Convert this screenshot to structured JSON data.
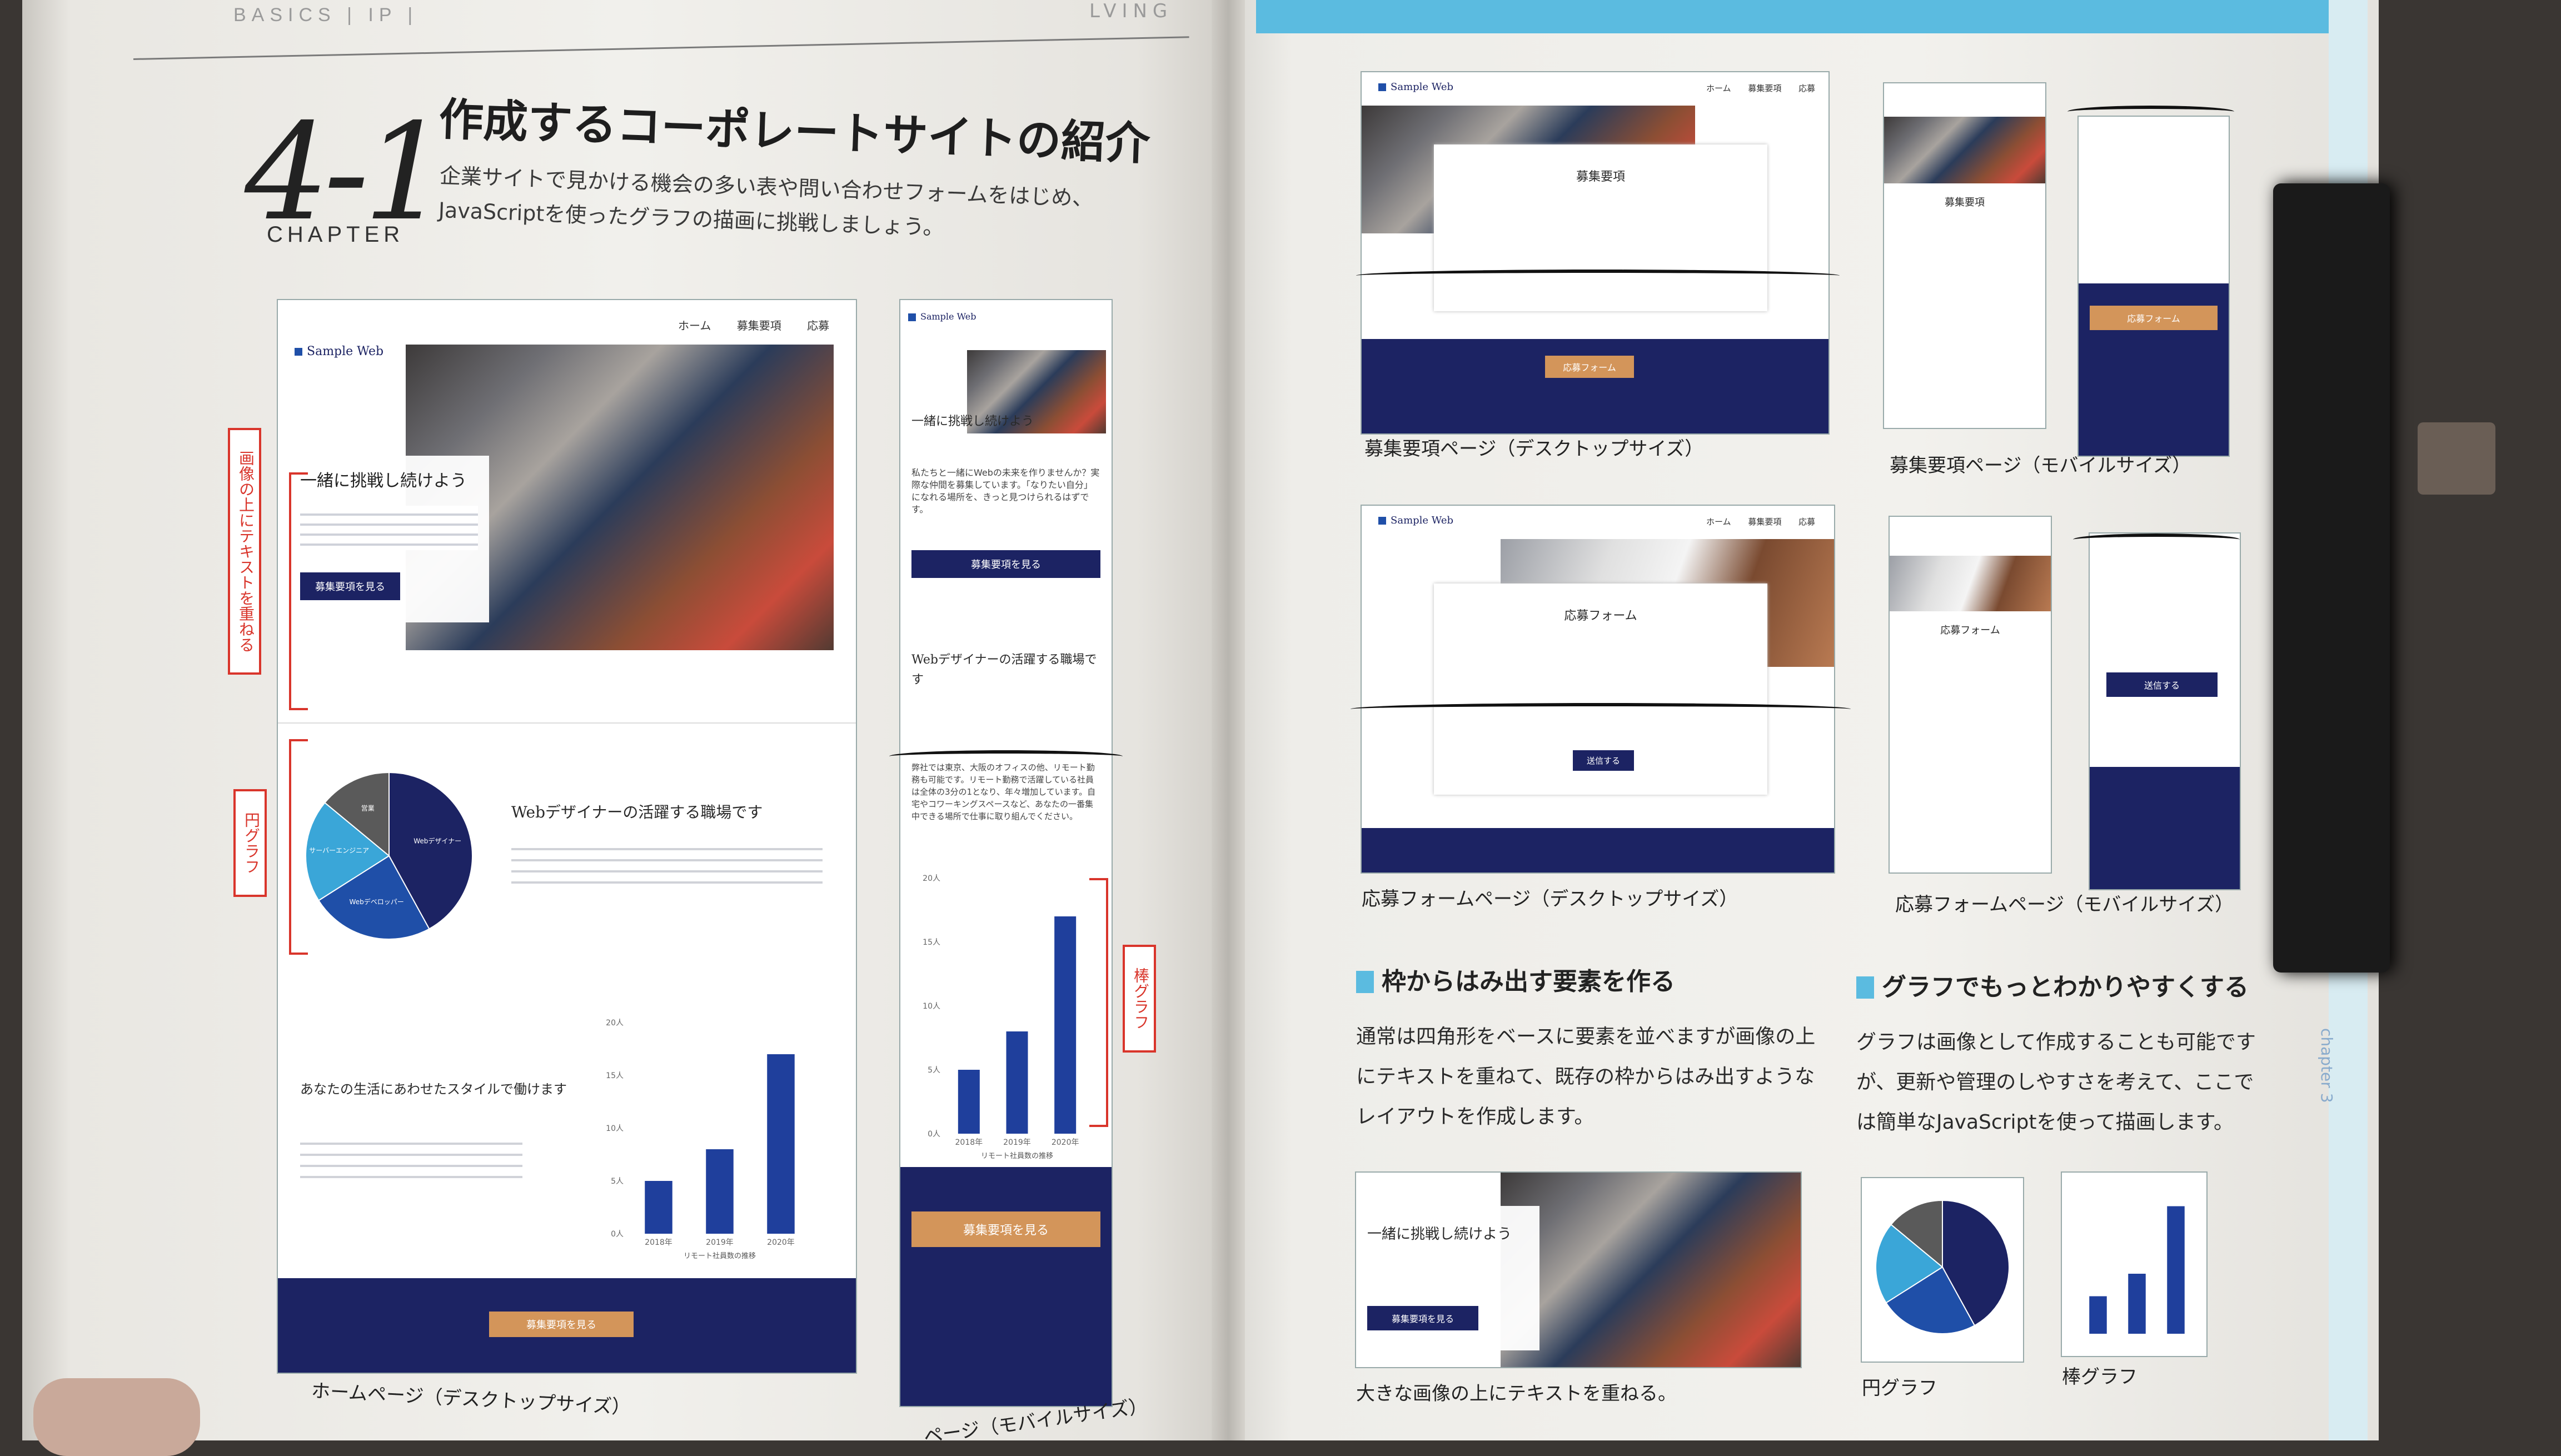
{
  "running_head": {
    "left": "BASICS | IP |",
    "right": "LVING"
  },
  "chapter": {
    "number": "4-1",
    "word": "CHAPTER",
    "title": "作成するコーポレートサイトの紹介",
    "lead": "企業サイトで見かける機会の多い表や問い合わせフォームをはじめ、JavaScriptを使ったグラフの描画に挑戦しましょう。"
  },
  "desktop_home": {
    "logo": "Sample Web",
    "nav": [
      "ホーム",
      "募集要項",
      "応募"
    ],
    "hero_heading": "一緒に挑戦し続けよう",
    "hero_button": "募集要項を見る",
    "section_heading": "Webデザイナーの活躍する職場です",
    "style_heading": "あなたの生活にあわせたスタイルで働けます",
    "footer_button": "募集要項を見る",
    "caption": "ホームページ（デスクトップサイズ）"
  },
  "mobile_home": {
    "logo": "Sample Web",
    "hero_heading": "一緒に挑戦し続けよう",
    "hero_text": "私たちと一緒にWebの未来を作りませんか？実際な仲間を募集しています。「なりたい自分」になれる場所を、きっと見つけられるはずです。",
    "hero_button": "募集要項を見る",
    "section_heading": "Webデザイナーの活躍する職場です",
    "body_text": "弊社では東京、大阪のオフィスの他、リモート勤務も可能です。リモート勤務で活躍している社員は全体の3分の1となり、年々増加しています。自宅やコワーキングスペースなど、あなたの一番集中できる場所で仕事に取り組んでください。",
    "footer_button": "募集要項を見る",
    "caption": "ページ（モバイルサイズ）"
  },
  "annotations": {
    "overlap_text": "画像の上にテキストを重ねる",
    "pie": "円グラフ",
    "bar": "棒グラフ"
  },
  "chart_data": [
    {
      "type": "bar",
      "categories": [
        "2018年",
        "2019年",
        "2020年"
      ],
      "values": [
        5,
        8,
        17
      ],
      "ylim": [
        0,
        20
      ],
      "y_ticks": [
        "0人",
        "5人",
        "10人",
        "15人",
        "20人"
      ],
      "xlabel": "リモート社員数の推移",
      "colors": [
        "#1f3f9c"
      ]
    },
    {
      "type": "pie",
      "labels": [
        "Webデザイナー",
        "Webデベロッパー",
        "サーバーエンジニア",
        "営業"
      ],
      "values": [
        42,
        24,
        20,
        14
      ],
      "colors": [
        "#1c2363",
        "#1f4fa8",
        "#3aa6d8",
        "#5a5a5a"
      ]
    }
  ],
  "right_page": {
    "recruit_desktop": {
      "logo": "Sample Web",
      "nav": [
        "ホーム",
        "募集要項",
        "応募"
      ],
      "heading": "募集要項",
      "button": "応募フォーム",
      "caption": "募集要項ページ（デスクトップサイズ）"
    },
    "recruit_mobile": {
      "heading": "募集要項",
      "button": "応募フォーム",
      "caption": "募集要項ページ（モバイルサイズ）"
    },
    "form_desktop": {
      "logo": "Sample Web",
      "nav": [
        "ホーム",
        "募集要項",
        "応募"
      ],
      "heading": "応募フォーム",
      "button": "送信する",
      "caption": "応募フォームページ（デスクトップサイズ）"
    },
    "form_mobile": {
      "heading": "応募フォーム",
      "button": "送信する",
      "caption": "応募フォームページ（モバイルサイズ）"
    },
    "section1": {
      "heading": "枠からはみ出す要素を作る",
      "body": "通常は四角形をベースに要素を並べますが画像の上にテキストを重ねて、既存の枠からはみ出すようなレイアウトを作成します。"
    },
    "section2": {
      "heading": "グラフでもっとわかりやすくする",
      "body": "グラフは画像として作成することも可能ですが、更新や管理のしやすさを考えて、ここでは簡単なJavaScriptを使って描画します。"
    },
    "example_caption": "大きな画像の上にテキストを重ねる。",
    "example_heading": "一緒に挑戦し続けよう",
    "example_button": "募集要項を見る",
    "pie_caption": "円グラフ",
    "bar_caption": "棒グラフ",
    "side_label": "chapter 3"
  }
}
